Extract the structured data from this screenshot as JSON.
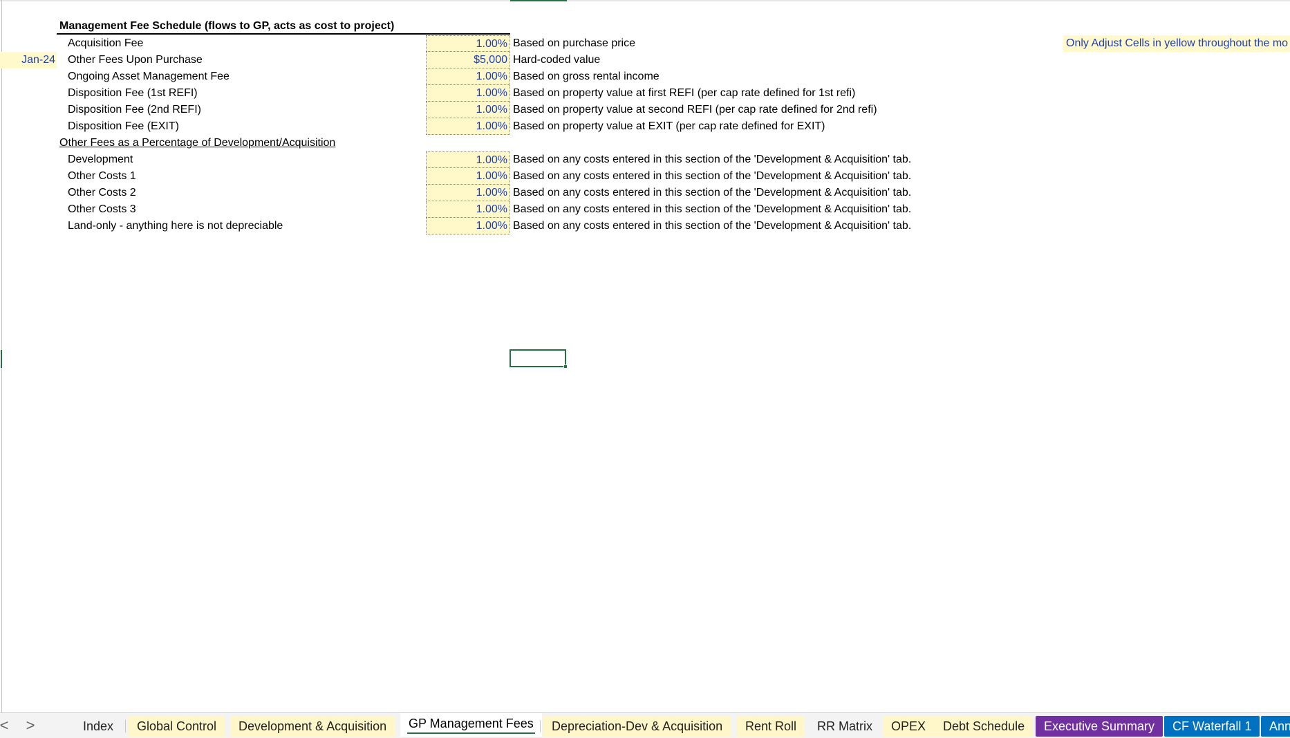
{
  "header": {
    "title": "Management Fee Schedule (flows to GP, acts as cost to project)",
    "hint": "Only Adjust Cells in yellow throughout the mo"
  },
  "fees": [
    {
      "date": "",
      "label": "Acquisition Fee",
      "value": "1.00%",
      "note": "Based on purchase price"
    },
    {
      "date": "Jan-24",
      "label": "Other Fees Upon Purchase",
      "value": "$5,000",
      "note": "Hard-coded value"
    },
    {
      "date": "",
      "label": "Ongoing Asset Management Fee",
      "value": "1.00%",
      "note": "Based on gross rental income"
    },
    {
      "date": "",
      "label": "Disposition Fee (1st REFI)",
      "value": "1.00%",
      "note": "Based on property value at first REFI (per cap rate defined for 1st refi)"
    },
    {
      "date": "",
      "label": "Disposition Fee (2nd REFI)",
      "value": "1.00%",
      "note": "Based on property value at second REFI (per cap rate defined for 2nd refi)"
    },
    {
      "date": "",
      "label": "Disposition Fee (EXIT)",
      "value": "1.00%",
      "note": "Based on property value at EXIT (per cap rate defined for EXIT)"
    }
  ],
  "other_section": {
    "title": "Other Fees as a Percentage of Development/Acquisition",
    "rows": [
      {
        "label": "Development",
        "value": "1.00%",
        "note": "Based on any costs entered in this section of the 'Development & Acquisition' tab."
      },
      {
        "label": "Other Costs 1",
        "value": "1.00%",
        "note": "Based on any costs entered in this section of the 'Development & Acquisition' tab."
      },
      {
        "label": "Other Costs 2",
        "value": "1.00%",
        "note": "Based on any costs entered in this section of the 'Development & Acquisition' tab."
      },
      {
        "label": "Other Costs 3",
        "value": "1.00%",
        "note": "Based on any costs entered in this section of the 'Development & Acquisition' tab."
      },
      {
        "label": "Land-only - anything here is not depreciable",
        "value": "1.00%",
        "note": "Based on any costs entered in this section of the 'Development & Acquisition' tab."
      }
    ]
  },
  "tabs": {
    "nav_prev": "<",
    "nav_next": ">",
    "items": [
      {
        "label": "Index",
        "style": "plain"
      },
      {
        "label": "Global Control",
        "style": "yellow"
      },
      {
        "label": "Development & Acquisition",
        "style": "yellow"
      },
      {
        "label": "GP Management Fees",
        "style": "active"
      },
      {
        "label": "Depreciation-Dev & Acquisition",
        "style": "yellow"
      },
      {
        "label": "Rent Roll",
        "style": "yellow"
      },
      {
        "label": "RR Matrix",
        "style": "plain"
      },
      {
        "label": "OPEX",
        "style": "yellow"
      },
      {
        "label": "Debt Schedule",
        "style": "yellow"
      },
      {
        "label": "Executive Summary",
        "style": "purple"
      },
      {
        "label": "CF Waterfall 1",
        "style": "blue"
      },
      {
        "label": "Ann",
        "style": "blue"
      }
    ]
  },
  "colors": {
    "input_fill": "#fff8c8",
    "input_text": "#1f3fb4",
    "excel_green": "#217346",
    "tab_purple": "#7030a0",
    "tab_blue": "#0070c0"
  }
}
